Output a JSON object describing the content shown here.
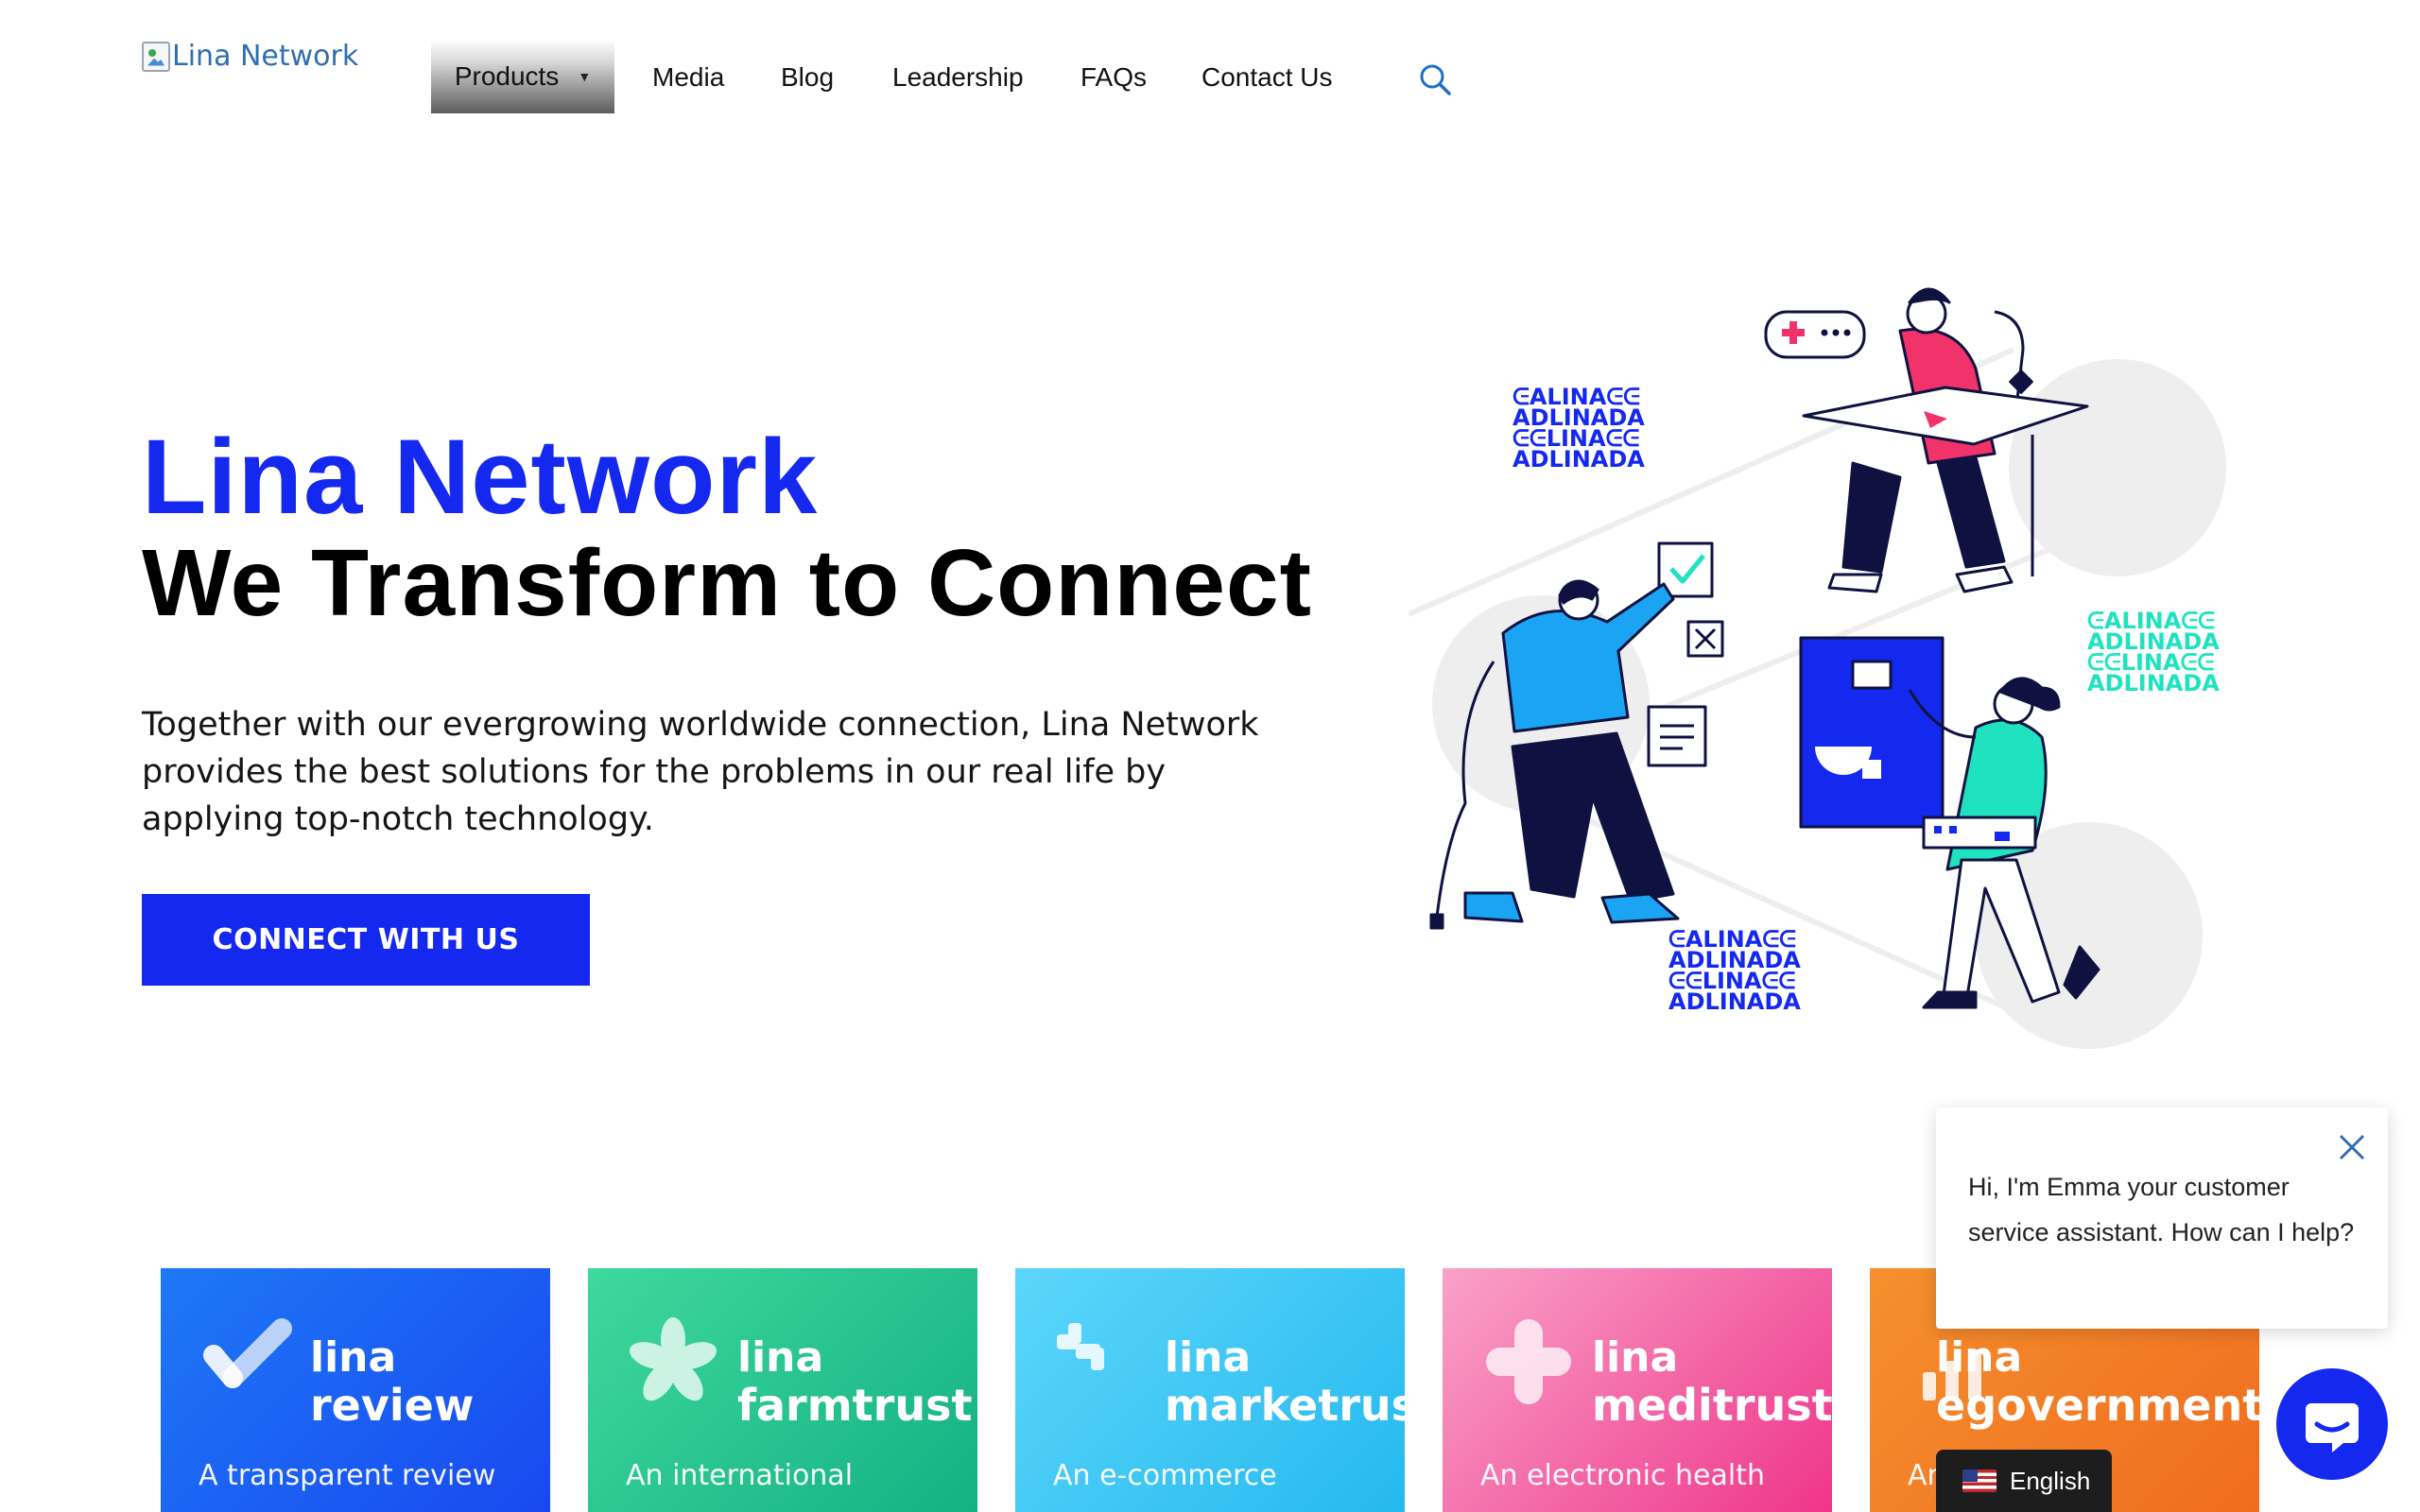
{
  "header": {
    "logo_alt": "Lina Network",
    "nav": {
      "products": "Products",
      "media": "Media",
      "blog": "Blog",
      "leadership": "Leadership",
      "faqs": "FAQs",
      "contact": "Contact Us"
    },
    "search_icon": "search-icon"
  },
  "hero": {
    "brand": "Lina Network",
    "title": "We Transform to Connect",
    "description": "Together with our evergrowing worldwide connection, Lina Network provides the best solutions for the problems in our real life by applying top-notch technology.",
    "cta": "CONNECT WITH US",
    "pattern_text": [
      "ᕮALINAᕮᕮ",
      "ADLINADA",
      "ᕮᕮLINAᕮᕮ",
      "ADLINADA"
    ]
  },
  "colors": {
    "brand_blue": "#1428f0",
    "teal": "#20e0c0",
    "pink": "#f2336b"
  },
  "products": [
    {
      "brand": "lina",
      "name": "review",
      "desc": "A transparent review",
      "icon": "check-icon"
    },
    {
      "brand": "lina",
      "name": "farmtrust",
      "desc": "An international",
      "icon": "flower-icon"
    },
    {
      "brand": "lina",
      "name": "marketrust",
      "desc": "An e-commerce",
      "icon": "puzzle-icon"
    },
    {
      "brand": "lina",
      "name": "meditrust",
      "desc": "An electronic health",
      "icon": "cross-icon"
    },
    {
      "brand": "lina",
      "name": "egovernment",
      "desc": "An",
      "icon": "government-icon"
    }
  ],
  "chat": {
    "message": "Hi, I'm Emma your customer service assistant. How can I help?",
    "close_icon": "close-icon",
    "launcher_icon": "chat-bubble-icon"
  },
  "language": {
    "label": "English",
    "flag_icon": "us-flag-icon"
  }
}
